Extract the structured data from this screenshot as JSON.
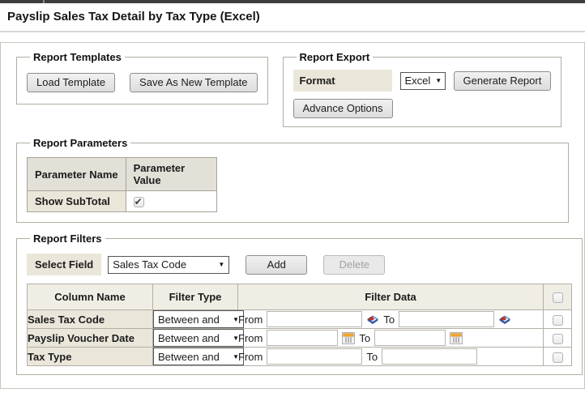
{
  "page": {
    "title": "Payslip Sales Tax Detail by Tax Type (Excel)"
  },
  "report_templates": {
    "legend": "Report Templates",
    "load_button": "Load Template",
    "save_button": "Save As New Template"
  },
  "report_export": {
    "legend": "Report Export",
    "format_label": "Format",
    "format_value": "Excel",
    "generate_button": "Generate Report",
    "advance_button": "Advance Options"
  },
  "report_parameters": {
    "legend": "Report Parameters",
    "columns": {
      "name": "Parameter Name",
      "value": "Parameter Value"
    },
    "rows": [
      {
        "name": "Show SubTotal",
        "checked": true
      }
    ]
  },
  "report_filters": {
    "legend": "Report Filters",
    "select_field_label": "Select Field",
    "select_field_value": "Sales Tax Code",
    "add_button": "Add",
    "delete_button": "Delete",
    "columns": {
      "name": "Column Name",
      "type": "Filter Type",
      "data": "Filter Data"
    },
    "from_label": "From",
    "to_label": "To",
    "rows": [
      {
        "name": "Sales Tax Code",
        "filter_type": "Between and",
        "icon": "lookup-icon",
        "from_value": "",
        "to_value": "",
        "checked": false
      },
      {
        "name": "Payslip Voucher Date",
        "filter_type": "Between and",
        "icon": "calendar-icon",
        "from_value": "",
        "to_value": "",
        "checked": false
      },
      {
        "name": "Tax Type",
        "filter_type": "Between and",
        "icon": "none",
        "from_value": "",
        "to_value": "",
        "checked": false
      }
    ]
  },
  "colors": {
    "accent_beige": "#eae6da",
    "filter_header_bg": "#f0ede4",
    "param_header_bg": "#e3e0d8",
    "fieldset_border": "#b1ada2",
    "table_border": "#b3afa5",
    "top_bar": "#3d3d3d",
    "lookup_icon_blue": "#3a66c8",
    "lookup_icon_red": "#c23124",
    "calendar_icon_orange": "#f2a72e"
  }
}
